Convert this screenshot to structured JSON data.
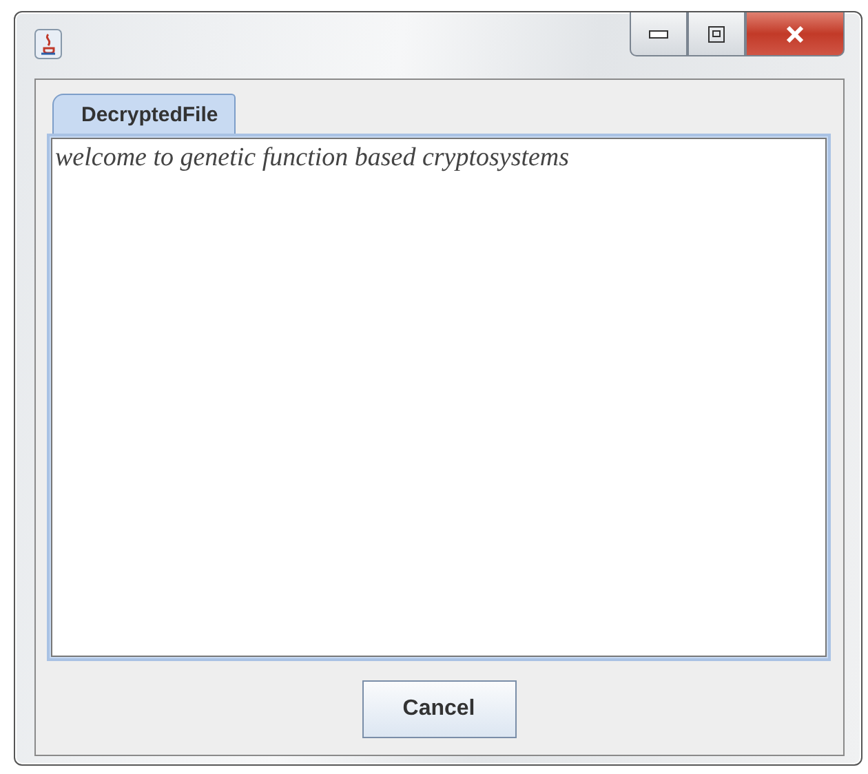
{
  "tabs": [
    {
      "label": "DecryptedFile",
      "selected": true
    }
  ],
  "text_area": {
    "value": "welcome to genetic function based cryptosystems"
  },
  "buttons": [
    {
      "label": "Cancel"
    }
  ]
}
